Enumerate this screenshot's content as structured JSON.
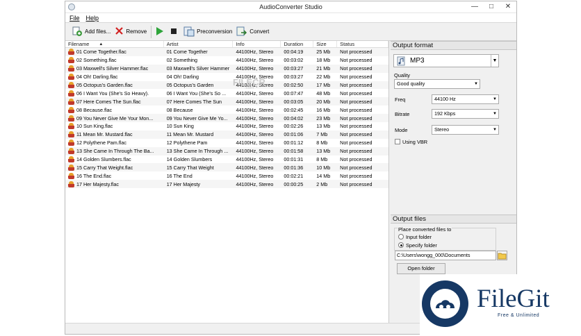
{
  "window": {
    "title": "AudioConverter Studio"
  },
  "menu": [
    "File",
    "Help"
  ],
  "toolbar": {
    "add": "Add files...",
    "remove": "Remove",
    "preconv": "Preconversion",
    "convert": "Convert"
  },
  "columns": {
    "filename": "Filename",
    "artist": "Artist",
    "info": "Info",
    "duration": "Duration",
    "size": "Size",
    "status": "Status"
  },
  "files": [
    {
      "name": "01 Come Together.flac",
      "artist": "01 Come Together",
      "info": "44100Hz, Stereo",
      "duration": "00:04:19",
      "size": "25 Mb",
      "status": "Not processed"
    },
    {
      "name": "02 Something.flac",
      "artist": "02 Something",
      "info": "44100Hz, Stereo",
      "duration": "00:03:02",
      "size": "18 Mb",
      "status": "Not processed"
    },
    {
      "name": "03 Maxwell's Silver Hammer.flac",
      "artist": "03 Maxwell's Silver Hammer",
      "info": "44100Hz, Stereo",
      "duration": "00:03:27",
      "size": "21 Mb",
      "status": "Not processed"
    },
    {
      "name": "04 Oh! Darling.flac",
      "artist": "04 Oh! Darling",
      "info": "44100Hz, Stereo",
      "duration": "00:03:27",
      "size": "22 Mb",
      "status": "Not processed"
    },
    {
      "name": "05 Octopus's Garden.flac",
      "artist": "05 Octopus's Garden",
      "info": "44100Hz, Stereo",
      "duration": "00:02:50",
      "size": "17 Mb",
      "status": "Not processed"
    },
    {
      "name": "06 I Want You (She's So Heavy).",
      "artist": "06 I Want You (She's So ...",
      "info": "44100Hz, Stereo",
      "duration": "00:07:47",
      "size": "48 Mb",
      "status": "Not processed"
    },
    {
      "name": "07 Here Comes The Sun.flac",
      "artist": "07 Here Comes The Sun",
      "info": "44100Hz, Stereo",
      "duration": "00:03:05",
      "size": "20 Mb",
      "status": "Not processed"
    },
    {
      "name": "08 Because.flac",
      "artist": "08 Because",
      "info": "44100Hz, Stereo",
      "duration": "00:02:45",
      "size": "16 Mb",
      "status": "Not processed"
    },
    {
      "name": "09 You Never Give Me Your Mon...",
      "artist": "09 You Never Give Me Yo...",
      "info": "44100Hz, Stereo",
      "duration": "00:04:02",
      "size": "23 Mb",
      "status": "Not processed"
    },
    {
      "name": "10 Sun King.flac",
      "artist": "10 Sun King",
      "info": "44100Hz, Stereo",
      "duration": "00:02:26",
      "size": "13 Mb",
      "status": "Not processed"
    },
    {
      "name": "11 Mean Mr. Mustard.flac",
      "artist": "11 Mean Mr. Mustard",
      "info": "44100Hz, Stereo",
      "duration": "00:01:06",
      "size": "7 Mb",
      "status": "Not processed"
    },
    {
      "name": "12 Polythene Pam.flac",
      "artist": "12 Polythene Pam",
      "info": "44100Hz, Stereo",
      "duration": "00:01:12",
      "size": "8 Mb",
      "status": "Not processed"
    },
    {
      "name": "13 She Came In Through The Ba...",
      "artist": "13 She Came In Through ...",
      "info": "44100Hz, Stereo",
      "duration": "00:01:58",
      "size": "13 Mb",
      "status": "Not processed"
    },
    {
      "name": "14 Golden Slumbers.flac",
      "artist": "14 Golden Slumbers",
      "info": "44100Hz, Stereo",
      "duration": "00:01:31",
      "size": "8 Mb",
      "status": "Not processed"
    },
    {
      "name": "15 Carry That Weight.flac",
      "artist": "15 Carry That Weight",
      "info": "44100Hz, Stereo",
      "duration": "00:01:36",
      "size": "10 Mb",
      "status": "Not processed"
    },
    {
      "name": "16 The End.flac",
      "artist": "16 The End",
      "info": "44100Hz, Stereo",
      "duration": "00:02:21",
      "size": "14 Mb",
      "status": "Not processed"
    },
    {
      "name": "17 Her Majesty.flac",
      "artist": "17 Her Majesty",
      "info": "44100Hz, Stereo",
      "duration": "00:00:25",
      "size": "2 Mb",
      "status": "Not processed"
    }
  ],
  "output_format": {
    "header": "Output format",
    "format": "MP3",
    "quality_label": "Quality",
    "quality": "Good quality",
    "freq_label": "Freq",
    "freq": "44100 Hz",
    "bitrate_label": "Bitrate",
    "bitrate": "192 Kbps",
    "mode_label": "Mode",
    "mode": "Stereo",
    "vbr_label": "Using VBR",
    "vbr_checked": false
  },
  "output_files": {
    "header": "Output files",
    "group_label": "Place converted files to",
    "radio_input": "Input folder",
    "radio_specify": "Specify folder",
    "selected": "specify",
    "path": "C:\\Users\\wongg_000\\Documents",
    "open_label": "Open folder"
  },
  "watermark": {
    "filecr": "FILECR",
    "filecr_sub": ".com",
    "filegit": "FileGit",
    "filegit_tag": "Free & Unlimited"
  },
  "colors": {
    "play": "#2ea43a",
    "remove": "#d22222",
    "brand": "#163864"
  }
}
